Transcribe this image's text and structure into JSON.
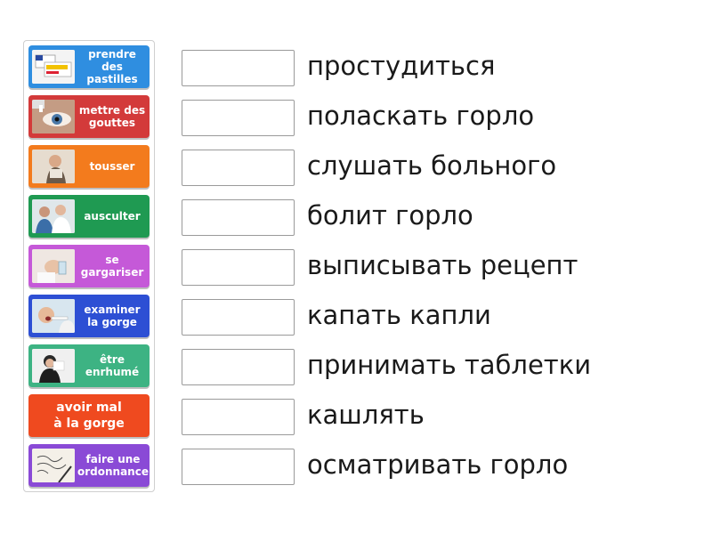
{
  "colors": {
    "card1": "#2f8ee0",
    "card2": "#d33a3a",
    "card3": "#f37b1d",
    "card4": "#1f9a52",
    "card5": "#c559d8",
    "card6": "#2d4fd4",
    "card7": "#3db383",
    "card8": "#ef4a1f",
    "card9": "#8a4ad6"
  },
  "cards": [
    {
      "label": "prendre des\npastilles",
      "icon": "pastilles-photo"
    },
    {
      "label": "mettre des\ngouttes",
      "icon": "eye-drops-photo"
    },
    {
      "label": "tousser",
      "icon": "coughing-photo"
    },
    {
      "label": "ausculter",
      "icon": "doctor-exam-photo"
    },
    {
      "label": "se\ngargariser",
      "icon": "gargling-photo"
    },
    {
      "label": "examiner\nla gorge",
      "icon": "throat-exam-photo"
    },
    {
      "label": "être\nenrhumé",
      "icon": "cold-sneeze-photo"
    },
    {
      "label": "avoir mal\nà la gorge",
      "icon": ""
    },
    {
      "label": "faire une\nordonnance",
      "icon": "prescription-photo"
    }
  ],
  "words": [
    "простудиться",
    "поласкать горло",
    "слушать больного",
    "болит горло",
    "выписывать рецепт",
    "капать капли",
    "принимать таблетки",
    "кашлять",
    "осматривать горло"
  ]
}
